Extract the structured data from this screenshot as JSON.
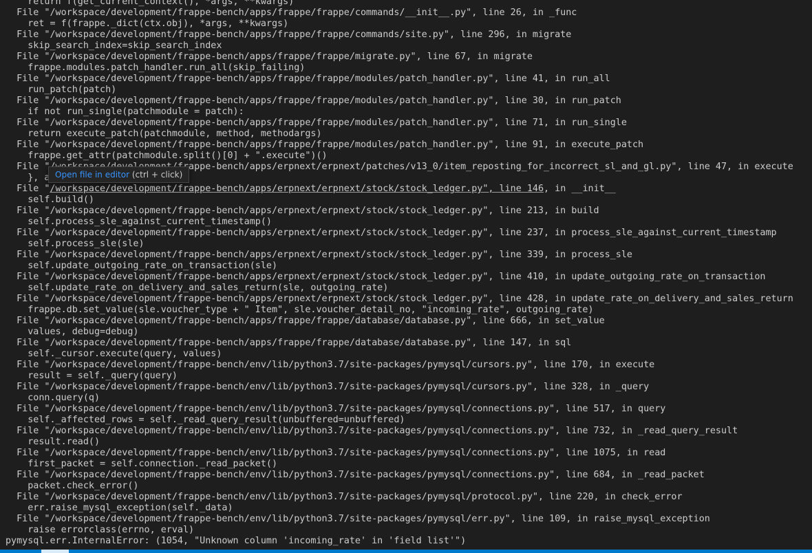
{
  "terminal": {
    "lines": [
      "    return f(get_current_context(), *args, **kwargs)",
      "  File \"/workspace/development/frappe-bench/apps/frappe/frappe/commands/__init__.py\", line 26, in _func",
      "    ret = f(frappe._dict(ctx.obj), *args, **kwargs)",
      "  File \"/workspace/development/frappe-bench/apps/frappe/frappe/commands/site.py\", line 296, in migrate",
      "    skip_search_index=skip_search_index",
      "  File \"/workspace/development/frappe-bench/apps/frappe/frappe/migrate.py\", line 67, in migrate",
      "    frappe.modules.patch_handler.run_all(skip_failing)",
      "  File \"/workspace/development/frappe-bench/apps/frappe/frappe/modules/patch_handler.py\", line 41, in run_all",
      "    run_patch(patch)",
      "  File \"/workspace/development/frappe-bench/apps/frappe/frappe/modules/patch_handler.py\", line 30, in run_patch",
      "    if not run_single(patchmodule = patch):",
      "  File \"/workspace/development/frappe-bench/apps/frappe/frappe/modules/patch_handler.py\", line 71, in run_single",
      "    return execute_patch(patchmodule, method, methodargs)",
      "  File \"/workspace/development/frappe-bench/apps/frappe/frappe/modules/patch_handler.py\", line 91, in execute_patch",
      "    frappe.get_attr(patchmodule.split()[0] + \".execute\")()",
      "  File \"/workspace/development/frappe-bench/apps/erpnext/erpnext/patches/v13_0/item_reposting_for_incorrect_sl_and_gl.py\", line 47, in execute",
      "    }, allow_negative_stock=True)",
      "",
      "    self.build()",
      "  File \"/workspace/development/frappe-bench/apps/erpnext/erpnext/stock/stock_ledger.py\", line 213, in build",
      "    self.process_sle_against_current_timestamp()",
      "  File \"/workspace/development/frappe-bench/apps/erpnext/erpnext/stock/stock_ledger.py\", line 237, in process_sle_against_current_timestamp",
      "    self.process_sle(sle)",
      "  File \"/workspace/development/frappe-bench/apps/erpnext/erpnext/stock/stock_ledger.py\", line 339, in process_sle",
      "    self.update_outgoing_rate_on_transaction(sle)",
      "  File \"/workspace/development/frappe-bench/apps/erpnext/erpnext/stock/stock_ledger.py\", line 410, in update_outgoing_rate_on_transaction",
      "    self.update_rate_on_delivery_and_sales_return(sle, outgoing_rate)",
      "  File \"/workspace/development/frappe-bench/apps/erpnext/erpnext/stock/stock_ledger.py\", line 428, in update_rate_on_delivery_and_sales_return",
      "    frappe.db.set_value(sle.voucher_type + \" Item\", sle.voucher_detail_no, \"incoming_rate\", outgoing_rate)",
      "  File \"/workspace/development/frappe-bench/apps/frappe/frappe/database/database.py\", line 666, in set_value",
      "    values, debug=debug)",
      "  File \"/workspace/development/frappe-bench/apps/frappe/frappe/database/database.py\", line 147, in sql",
      "    self._cursor.execute(query, values)",
      "  File \"/workspace/development/frappe-bench/env/lib/python3.7/site-packages/pymysql/cursors.py\", line 170, in execute",
      "    result = self._query(query)",
      "  File \"/workspace/development/frappe-bench/env/lib/python3.7/site-packages/pymysql/cursors.py\", line 328, in _query",
      "    conn.query(q)",
      "  File \"/workspace/development/frappe-bench/env/lib/python3.7/site-packages/pymysql/connections.py\", line 517, in query",
      "    self._affected_rows = self._read_query_result(unbuffered=unbuffered)",
      "  File \"/workspace/development/frappe-bench/env/lib/python3.7/site-packages/pymysql/connections.py\", line 732, in _read_query_result",
      "    result.read()",
      "  File \"/workspace/development/frappe-bench/env/lib/python3.7/site-packages/pymysql/connections.py\", line 1075, in read",
      "    first_packet = self.connection._read_packet()",
      "  File \"/workspace/development/frappe-bench/env/lib/python3.7/site-packages/pymysql/connections.py\", line 684, in _read_packet",
      "    packet.check_error()",
      "  File \"/workspace/development/frappe-bench/env/lib/python3.7/site-packages/pymysql/protocol.py\", line 220, in check_error",
      "    err.raise_mysql_exception(self._data)",
      "  File \"/workspace/development/frappe-bench/env/lib/python3.7/site-packages/pymysql/err.py\", line 109, in raise_mysql_exception",
      "    raise errorclass(errno, erval)",
      "pymysql.err.InternalError: (1054, \"Unknown column 'incoming_rate' in 'field list'\")"
    ],
    "hovered_line": {
      "prefix": "  File \"",
      "link": "/workspace/development/frappe-bench/apps/erpnext/erpnext/stock/stock_ledger.py\", line 146",
      "suffix": ", in __init__"
    }
  },
  "tooltip": {
    "action": "Open file in editor",
    "hint": "(ctrl + click)"
  },
  "colors": {
    "background": "#1e1e1e",
    "foreground": "#cccccc",
    "link": "#3794ff",
    "statusbar": "#007acc"
  }
}
